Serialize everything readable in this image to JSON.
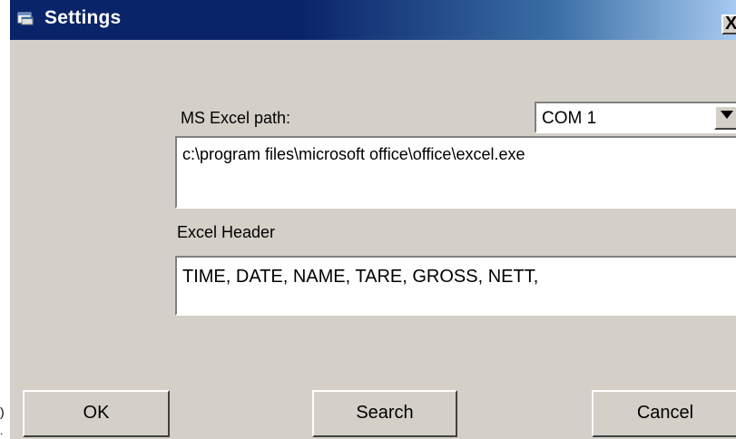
{
  "window": {
    "title": "Settings",
    "close_label": "X"
  },
  "labels": {
    "excel_path": "MS Excel path:",
    "excel_header": "Excel Header"
  },
  "port_select": {
    "value": "COM 1"
  },
  "fields": {
    "excel_path_value": "c:\\program files\\microsoft office\\office\\excel.exe",
    "excel_header_value": "TIME, DATE, NAME, TARE, GROSS, NETT,"
  },
  "buttons": {
    "ok": "OK",
    "search": "Search",
    "cancel": "Cancel"
  },
  "colors": {
    "titlebar_start": "#0a246a",
    "titlebar_end": "#a6caf0",
    "window_face": "#d4d0c8"
  }
}
